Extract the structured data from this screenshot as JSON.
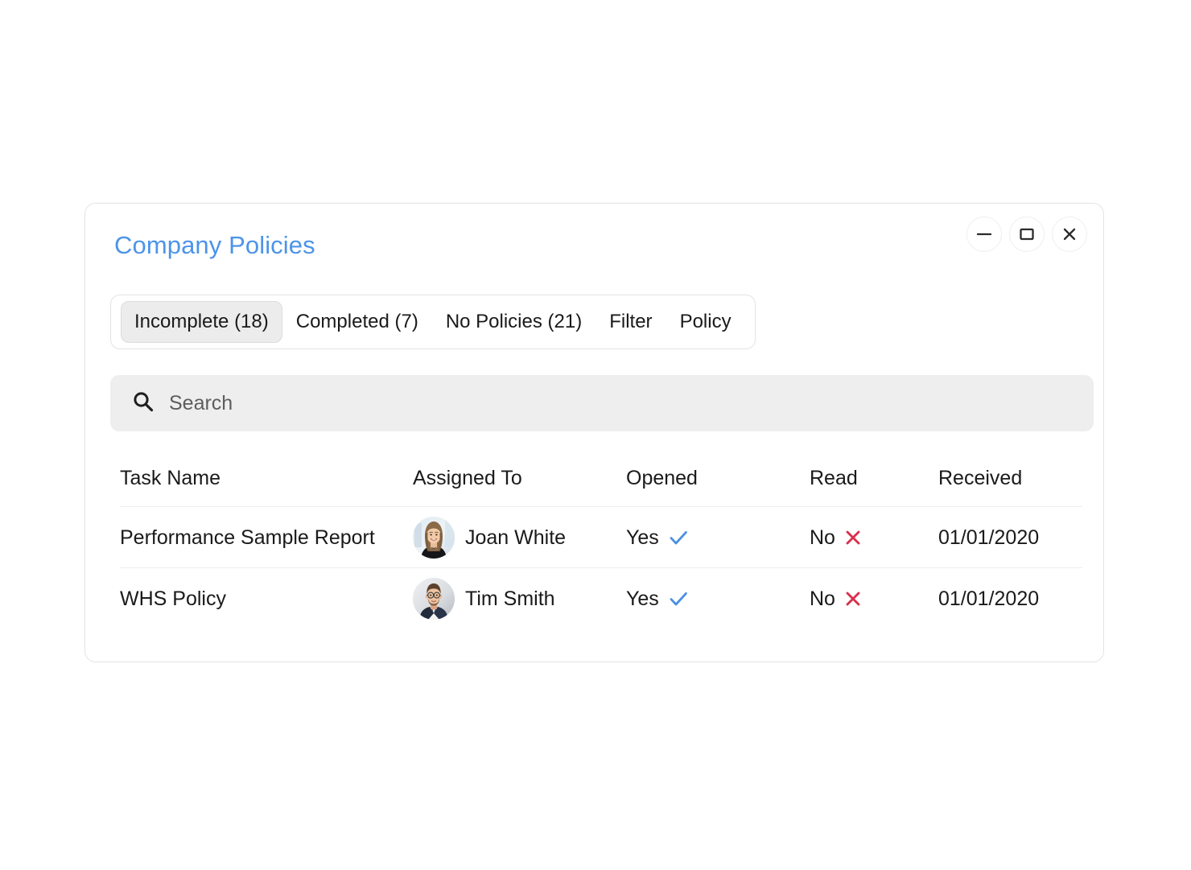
{
  "window": {
    "title": "Company Policies",
    "controls": [
      {
        "name": "minimize",
        "label": "—"
      },
      {
        "name": "maximize",
        "label": "□"
      },
      {
        "name": "close",
        "label": "×"
      }
    ]
  },
  "tabs": [
    {
      "label": "Incomplete (18)",
      "active": true
    },
    {
      "label": "Completed (7)",
      "active": false
    },
    {
      "label": "No Policies (21)",
      "active": false
    },
    {
      "label": "Filter",
      "active": false
    },
    {
      "label": "Policy",
      "active": false
    }
  ],
  "search": {
    "placeholder": "Search",
    "value": ""
  },
  "table": {
    "columns": [
      "Task Name",
      "Assigned To",
      "Opened",
      "Read",
      "Received"
    ],
    "rows": [
      {
        "task_name": "Performance Sample Report",
        "assignee": "Joan White",
        "avatar": "woman-avatar",
        "opened": "Yes",
        "opened_icon": "check-icon",
        "read": "No",
        "read_icon": "cross-icon",
        "received": "01/01/2020"
      },
      {
        "task_name": "WHS Policy",
        "assignee": "Tim Smith",
        "avatar": "man-avatar",
        "opened": "Yes",
        "opened_icon": "check-icon",
        "read": "No",
        "read_icon": "cross-icon",
        "received": "01/01/2020"
      }
    ]
  },
  "colors": {
    "title": "#4d94e8",
    "check": "#4a90e2",
    "cross": "#d8304c",
    "card_border": "#e3e3e3",
    "search_bg": "#eeeeee",
    "tab_active_bg": "#ececec"
  }
}
